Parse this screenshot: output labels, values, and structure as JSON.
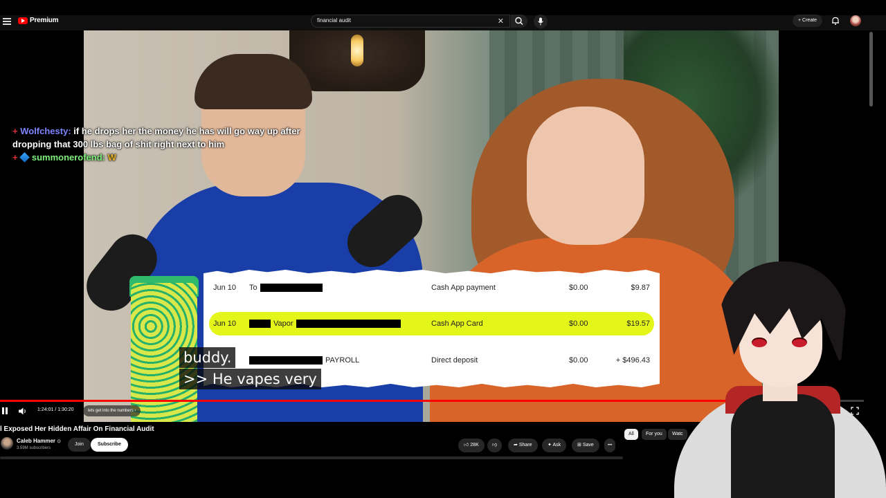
{
  "topbar": {
    "logo_text": "Premium",
    "search_value": "financial audit",
    "clear_glyph": "✕",
    "create_label": "Create",
    "create_glyph": "+",
    "icons": [
      "menu-icon",
      "youtube-logo-icon",
      "search-icon",
      "microphone-icon",
      "bell-icon",
      "account-avatar"
    ]
  },
  "chat": {
    "messages": [
      {
        "badge": "+",
        "user": "Wolfchesty:",
        "text": "if he drops her the money he has will go way up after dropping that 300 lbs bag of shit right next to him"
      },
      {
        "badge": "+",
        "user": "summonerofend:",
        "text": "W"
      }
    ]
  },
  "receipt": {
    "rows": [
      {
        "date": "Jun 10",
        "desc_prefix": "To",
        "desc_suffix": "",
        "type": "Cash App payment",
        "fee": "$0.00",
        "amount": "$9.87",
        "highlighted": false
      },
      {
        "date": "Jun 10",
        "desc_prefix": "",
        "desc_suffix": "Vapor",
        "type": "Cash App Card",
        "fee": "$0.00",
        "amount": "$19.57",
        "highlighted": true
      },
      {
        "date": "",
        "desc_prefix": "",
        "desc_suffix": "PAYROLL",
        "type": "Direct deposit",
        "fee": "$0.00",
        "amount": "+ $496.43",
        "highlighted": false
      }
    ],
    "highlight_color": "#e4f51a"
  },
  "captions": {
    "line1": "buddy.",
    "line2": ">> He vapes very"
  },
  "player": {
    "current_time": "1:24:01",
    "duration": "1:30:20",
    "time_separator": "/",
    "chapter": "lets get into the numbers",
    "chapter_chevron": "›",
    "progress_fraction": 0.93,
    "accent": "#ff0000"
  },
  "video_meta": {
    "title": "l Exposed Her Hidden Affair On Financial Audit",
    "channel_name": "Caleb Hammer",
    "verified_glyph": "⊙",
    "subscribers": "3.59M subscribers",
    "join_label": "Join",
    "subscribe_label": "Subscribe",
    "likes": "28K",
    "share_label": "Share",
    "ask_label": "Ask",
    "save_label": "Save",
    "more_glyph": "•••"
  },
  "chips": [
    {
      "label": "All",
      "active": true
    },
    {
      "label": "For you",
      "active": false
    },
    {
      "label": "Watc",
      "active": false
    }
  ]
}
